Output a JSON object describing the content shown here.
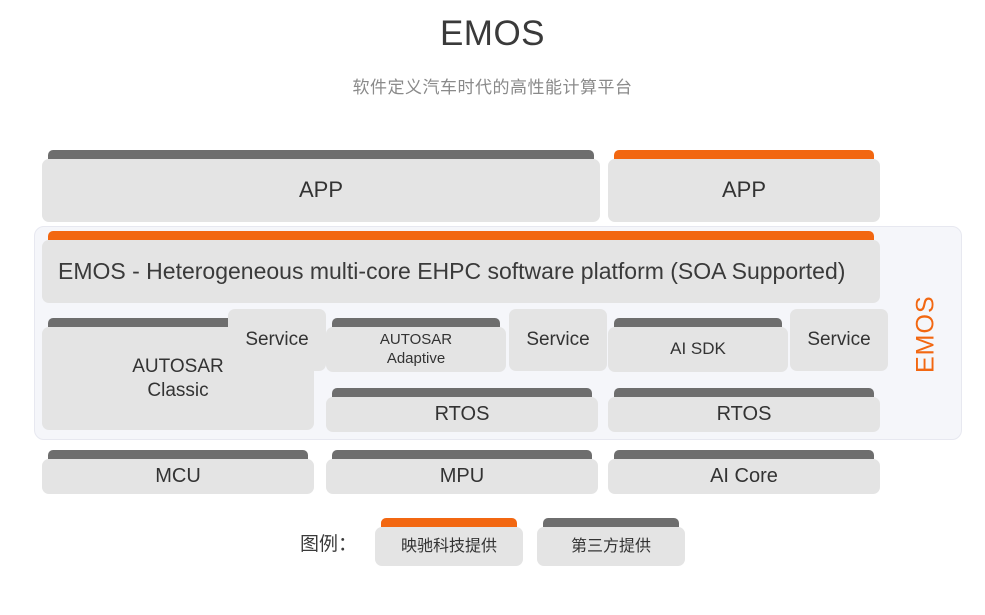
{
  "header": {
    "title": "EMOS",
    "subtitle": "软件定义汽车时代的高性能计算平台"
  },
  "colors": {
    "accent_orange": "#f26711",
    "bar_gray": "#6e6e6e",
    "box_body": "#e4e4e4",
    "container_bg": "#f5f6fa",
    "title_text": "#3a3a3a",
    "subtitle_text": "#8a8a8a"
  },
  "app_row": {
    "left_label": "APP",
    "right_label": "APP"
  },
  "platform": {
    "label": "EMOS - Heterogeneous multi-core EHPC software platform (SOA Supported)",
    "vertical_label": "EMOS"
  },
  "middle_row": {
    "autosar_classic": "AUTOSAR\nClassic",
    "autosar_classic_line1": "AUTOSAR",
    "autosar_classic_line2": "Classic",
    "autosar_adaptive_line1": "AUTOSAR",
    "autosar_adaptive_line2": "Adaptive",
    "ai_sdk": "AI SDK",
    "service_1": "Service",
    "service_2": "Service",
    "service_3": "Service",
    "rtos_1": "RTOS",
    "rtos_2": "RTOS"
  },
  "hardware_row": {
    "mcu": "MCU",
    "mpu": "MPU",
    "ai_core": "AI Core"
  },
  "legend": {
    "label": "图例：",
    "own_label": "映驰科技提供",
    "third_party_label": "第三方提供"
  }
}
